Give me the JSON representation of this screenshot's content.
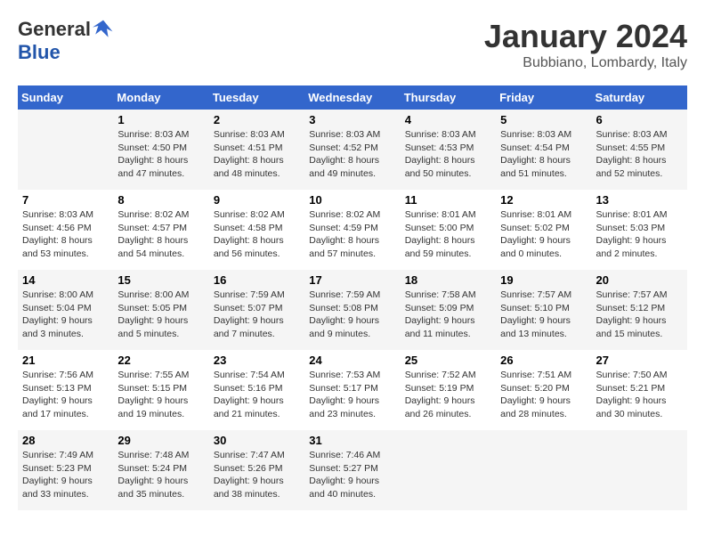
{
  "header": {
    "logo_general": "General",
    "logo_blue": "Blue",
    "month_title": "January 2024",
    "location": "Bubbiano, Lombardy, Italy"
  },
  "weekdays": [
    "Sunday",
    "Monday",
    "Tuesday",
    "Wednesday",
    "Thursday",
    "Friday",
    "Saturday"
  ],
  "weeks": [
    [
      {
        "day": "",
        "info": ""
      },
      {
        "day": "1",
        "info": "Sunrise: 8:03 AM\nSunset: 4:50 PM\nDaylight: 8 hours\nand 47 minutes."
      },
      {
        "day": "2",
        "info": "Sunrise: 8:03 AM\nSunset: 4:51 PM\nDaylight: 8 hours\nand 48 minutes."
      },
      {
        "day": "3",
        "info": "Sunrise: 8:03 AM\nSunset: 4:52 PM\nDaylight: 8 hours\nand 49 minutes."
      },
      {
        "day": "4",
        "info": "Sunrise: 8:03 AM\nSunset: 4:53 PM\nDaylight: 8 hours\nand 50 minutes."
      },
      {
        "day": "5",
        "info": "Sunrise: 8:03 AM\nSunset: 4:54 PM\nDaylight: 8 hours\nand 51 minutes."
      },
      {
        "day": "6",
        "info": "Sunrise: 8:03 AM\nSunset: 4:55 PM\nDaylight: 8 hours\nand 52 minutes."
      }
    ],
    [
      {
        "day": "7",
        "info": "Sunrise: 8:03 AM\nSunset: 4:56 PM\nDaylight: 8 hours\nand 53 minutes."
      },
      {
        "day": "8",
        "info": "Sunrise: 8:02 AM\nSunset: 4:57 PM\nDaylight: 8 hours\nand 54 minutes."
      },
      {
        "day": "9",
        "info": "Sunrise: 8:02 AM\nSunset: 4:58 PM\nDaylight: 8 hours\nand 56 minutes."
      },
      {
        "day": "10",
        "info": "Sunrise: 8:02 AM\nSunset: 4:59 PM\nDaylight: 8 hours\nand 57 minutes."
      },
      {
        "day": "11",
        "info": "Sunrise: 8:01 AM\nSunset: 5:00 PM\nDaylight: 8 hours\nand 59 minutes."
      },
      {
        "day": "12",
        "info": "Sunrise: 8:01 AM\nSunset: 5:02 PM\nDaylight: 9 hours\nand 0 minutes."
      },
      {
        "day": "13",
        "info": "Sunrise: 8:01 AM\nSunset: 5:03 PM\nDaylight: 9 hours\nand 2 minutes."
      }
    ],
    [
      {
        "day": "14",
        "info": "Sunrise: 8:00 AM\nSunset: 5:04 PM\nDaylight: 9 hours\nand 3 minutes."
      },
      {
        "day": "15",
        "info": "Sunrise: 8:00 AM\nSunset: 5:05 PM\nDaylight: 9 hours\nand 5 minutes."
      },
      {
        "day": "16",
        "info": "Sunrise: 7:59 AM\nSunset: 5:07 PM\nDaylight: 9 hours\nand 7 minutes."
      },
      {
        "day": "17",
        "info": "Sunrise: 7:59 AM\nSunset: 5:08 PM\nDaylight: 9 hours\nand 9 minutes."
      },
      {
        "day": "18",
        "info": "Sunrise: 7:58 AM\nSunset: 5:09 PM\nDaylight: 9 hours\nand 11 minutes."
      },
      {
        "day": "19",
        "info": "Sunrise: 7:57 AM\nSunset: 5:10 PM\nDaylight: 9 hours\nand 13 minutes."
      },
      {
        "day": "20",
        "info": "Sunrise: 7:57 AM\nSunset: 5:12 PM\nDaylight: 9 hours\nand 15 minutes."
      }
    ],
    [
      {
        "day": "21",
        "info": "Sunrise: 7:56 AM\nSunset: 5:13 PM\nDaylight: 9 hours\nand 17 minutes."
      },
      {
        "day": "22",
        "info": "Sunrise: 7:55 AM\nSunset: 5:15 PM\nDaylight: 9 hours\nand 19 minutes."
      },
      {
        "day": "23",
        "info": "Sunrise: 7:54 AM\nSunset: 5:16 PM\nDaylight: 9 hours\nand 21 minutes."
      },
      {
        "day": "24",
        "info": "Sunrise: 7:53 AM\nSunset: 5:17 PM\nDaylight: 9 hours\nand 23 minutes."
      },
      {
        "day": "25",
        "info": "Sunrise: 7:52 AM\nSunset: 5:19 PM\nDaylight: 9 hours\nand 26 minutes."
      },
      {
        "day": "26",
        "info": "Sunrise: 7:51 AM\nSunset: 5:20 PM\nDaylight: 9 hours\nand 28 minutes."
      },
      {
        "day": "27",
        "info": "Sunrise: 7:50 AM\nSunset: 5:21 PM\nDaylight: 9 hours\nand 30 minutes."
      }
    ],
    [
      {
        "day": "28",
        "info": "Sunrise: 7:49 AM\nSunset: 5:23 PM\nDaylight: 9 hours\nand 33 minutes."
      },
      {
        "day": "29",
        "info": "Sunrise: 7:48 AM\nSunset: 5:24 PM\nDaylight: 9 hours\nand 35 minutes."
      },
      {
        "day": "30",
        "info": "Sunrise: 7:47 AM\nSunset: 5:26 PM\nDaylight: 9 hours\nand 38 minutes."
      },
      {
        "day": "31",
        "info": "Sunrise: 7:46 AM\nSunset: 5:27 PM\nDaylight: 9 hours\nand 40 minutes."
      },
      {
        "day": "",
        "info": ""
      },
      {
        "day": "",
        "info": ""
      },
      {
        "day": "",
        "info": ""
      }
    ]
  ]
}
